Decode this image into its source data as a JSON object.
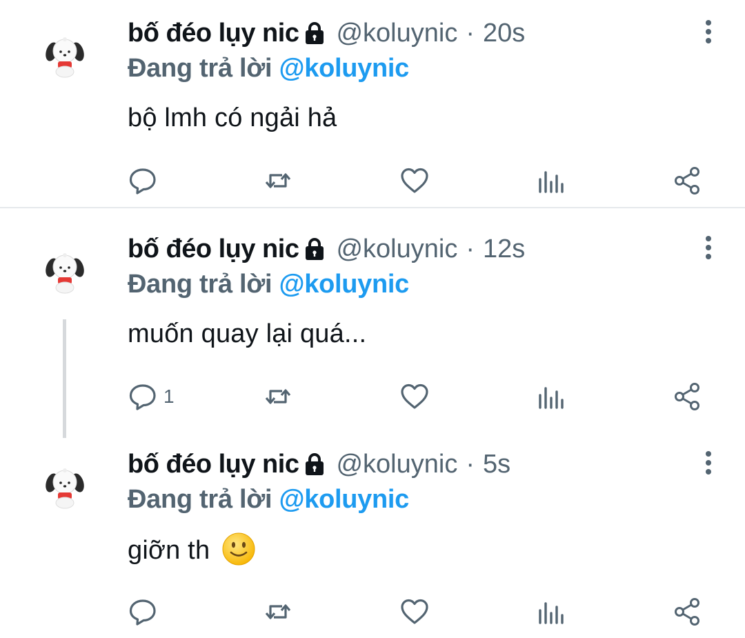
{
  "tweets": [
    {
      "author": "bố đéo lụy nic",
      "handle": "@koluynic",
      "separator": "·",
      "time": "20s",
      "reply_prefix": "Đang trả lời",
      "reply_to": "@koluynic",
      "text": "bộ lmh có ngải hả",
      "reply_count": "",
      "emoji": ""
    },
    {
      "author": "bố đéo lụy nic",
      "handle": "@koluynic",
      "separator": "·",
      "time": "12s",
      "reply_prefix": "Đang trả lời",
      "reply_to": "@koluynic",
      "text": "muốn quay lại quá...",
      "reply_count": "1",
      "emoji": ""
    },
    {
      "author": "bố đéo lụy nic",
      "handle": "@koluynic",
      "separator": "·",
      "time": "5s",
      "reply_prefix": "Đang trả lời",
      "reply_to": "@koluynic",
      "text": "giỡn th",
      "reply_count": "",
      "emoji": "slightly-smiling-face"
    }
  ],
  "icons": {
    "lock": "lock-icon",
    "more": "more-vertical-icon",
    "reply": "reply-icon",
    "retweet": "retweet-icon",
    "like": "heart-icon",
    "views": "views-bar-chart-icon",
    "share": "share-icon"
  },
  "colors": {
    "text": "#0f1419",
    "secondary": "#536471",
    "mention": "#1d9bf0",
    "divider": "#e6e9ec",
    "thread_line": "#d6d9dc"
  }
}
